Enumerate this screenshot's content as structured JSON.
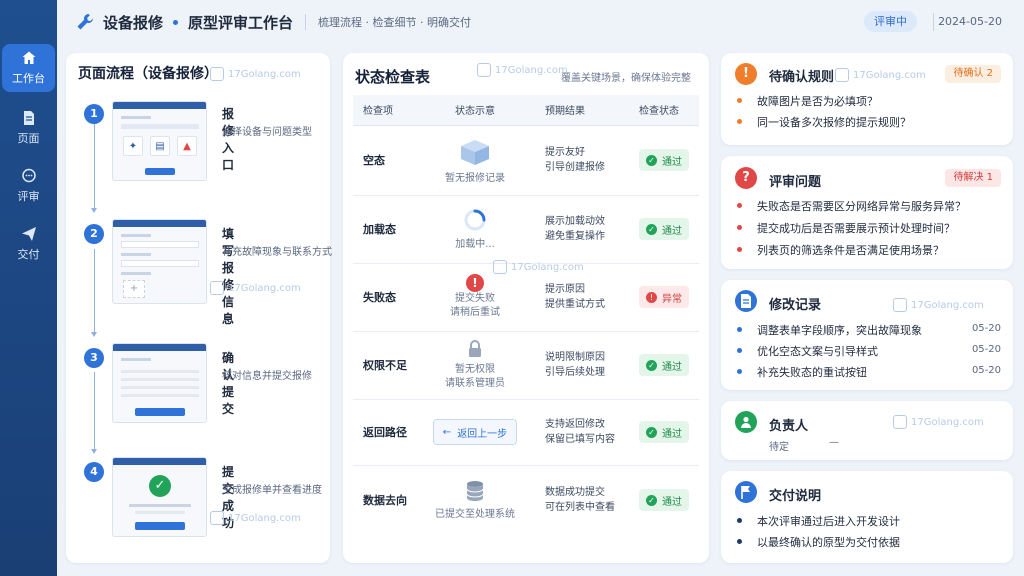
{
  "sidebar": {
    "items": [
      {
        "label": "工作台",
        "icon": "home-icon"
      },
      {
        "label": "页面",
        "icon": "page-icon"
      },
      {
        "label": "评审",
        "icon": "comment-icon"
      },
      {
        "label": "交付",
        "icon": "send-icon"
      }
    ]
  },
  "header": {
    "app_title": "设备报修",
    "subtitle": "原型评审工作台",
    "tagline": "梳理流程 · 检查细节 · 明确交付",
    "status": "评审中",
    "date": "2024-05-20"
  },
  "flow": {
    "title": "页面流程（设备报修）",
    "steps": [
      {
        "num": "1",
        "title": "报修入口",
        "desc": "选择设备与问题类型"
      },
      {
        "num": "2",
        "title": "填写报修信息",
        "desc": "补充故障现象与联系方式"
      },
      {
        "num": "3",
        "title": "确认提交",
        "desc": "核对信息并提交报修"
      },
      {
        "num": "4",
        "title": "提交成功",
        "desc": "生成报修单并查看进度"
      }
    ]
  },
  "checks": {
    "title": "状态检查表",
    "note": "覆盖关键场景，确保体验完整",
    "headers": [
      "检查项",
      "状态示意",
      "预期结果",
      "检查状态"
    ],
    "rows": [
      {
        "name": "空态",
        "demo": "暂无报修记录",
        "result1": "提示友好",
        "result2": "引导创建报修",
        "status": "通过",
        "ok": true
      },
      {
        "name": "加载态",
        "demo": "加载中...",
        "result1": "展示加载动效",
        "result2": "避免重复操作",
        "status": "通过",
        "ok": true
      },
      {
        "name": "失败态",
        "demo": "提交失败",
        "demo2": "请稍后重试",
        "result1": "提示原因",
        "result2": "提供重试方式",
        "status": "异常",
        "ok": false
      },
      {
        "name": "权限不足",
        "demo": "暂无权限",
        "demo2": "请联系管理员",
        "result1": "说明限制原因",
        "result2": "引导后续处理",
        "status": "通过",
        "ok": true
      },
      {
        "name": "返回路径",
        "demo": "返回上一步",
        "result1": "支持返回修改",
        "result2": "保留已填写内容",
        "status": "通过",
        "ok": true
      },
      {
        "name": "数据去向",
        "demo": "已提交至处理系统",
        "result1": "数据成功提交",
        "result2": "可在列表中查看",
        "status": "通过",
        "ok": true
      }
    ]
  },
  "pending": {
    "title": "待确认规则",
    "badge": "待确认 2",
    "items": [
      "故障图片是否为必填项？",
      "同一设备多次报修的提示规则？"
    ]
  },
  "issues": {
    "title": "评审问题",
    "badge": "待解决 1",
    "items": [
      "失败态是否需要区分网络异常与服务异常？",
      "提交成功后是否需要展示预计处理时间？",
      "列表页的筛选条件是否满足使用场景？"
    ]
  },
  "changes": {
    "title": "修改记录",
    "items": [
      {
        "text": "调整表单字段顺序，突出故障现象",
        "date": "05-20"
      },
      {
        "text": "优化空态文案与引导样式",
        "date": "05-20"
      },
      {
        "text": "补充失败态的重试按钮",
        "date": "05-20"
      }
    ]
  },
  "owner": {
    "title": "负责人",
    "status": "待定",
    "value": "—"
  },
  "delivery": {
    "title": "交付说明",
    "items": [
      "本次评审通过后进入开发设计",
      "以最终确认的原型为交付依据"
    ]
  },
  "watermark": "17Golang.com",
  "colors": {
    "accent": "#2f72d8",
    "sidebar": "#1f4f8f",
    "ok": "#22a35a",
    "warn": "#f07d2a",
    "danger": "#e04848"
  }
}
